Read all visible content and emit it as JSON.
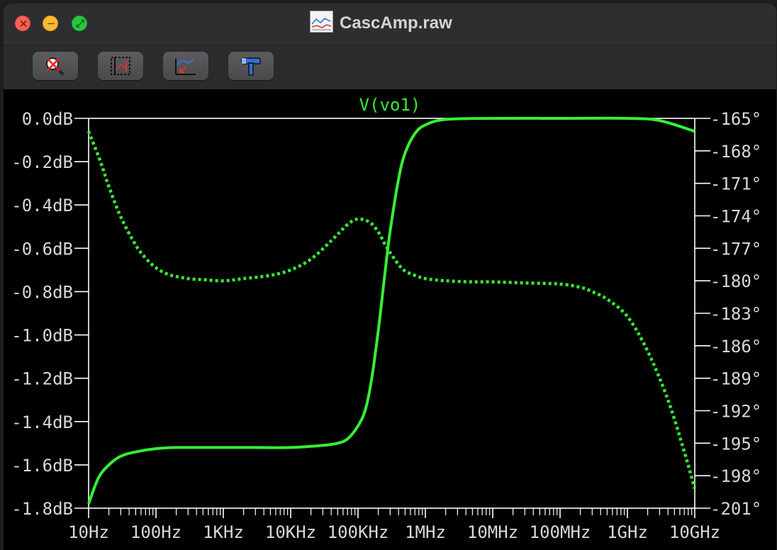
{
  "window": {
    "title": "CascAmp.raw"
  },
  "toolbar": {
    "buttons": [
      {
        "name": "zoom-cancel",
        "icon": "magnifier-cancel-icon"
      },
      {
        "name": "autorange",
        "icon": "autorange-icon"
      },
      {
        "name": "zoom-full",
        "icon": "zoom-full-icon"
      },
      {
        "name": "settings",
        "icon": "hammer-icon"
      }
    ]
  },
  "colors": {
    "trace": "#35ef35",
    "axis": "#ffffff",
    "text": "#d8d8d8",
    "background": "#000000"
  },
  "chart_data": {
    "type": "line",
    "title": "V(vo1)",
    "xlabel": "",
    "ylabel": "",
    "x_scale": "log",
    "xlim": [
      10,
      10000000000
    ],
    "ylim": [
      -1.8,
      0.0
    ],
    "y2lim": [
      -201,
      -165
    ],
    "x_ticks": [
      "10Hz",
      "100Hz",
      "1KHz",
      "10KHz",
      "100KHz",
      "1MHz",
      "10MHz",
      "100MHz",
      "1GHz",
      "10GHz"
    ],
    "y_ticks": [
      "0.0dB",
      "-0.2dB",
      "-0.4dB",
      "-0.6dB",
      "-0.8dB",
      "-1.0dB",
      "-1.2dB",
      "-1.4dB",
      "-1.6dB",
      "-1.8dB"
    ],
    "y2_ticks": [
      "-165°",
      "-168°",
      "-171°",
      "-174°",
      "-177°",
      "-180°",
      "-183°",
      "-186°",
      "-189°",
      "-192°",
      "-195°",
      "-198°",
      "-201°"
    ],
    "grid": false,
    "series": [
      {
        "name": "magnitude",
        "axis": "left",
        "unit": "dB",
        "style": "solid",
        "x": [
          10,
          14,
          20,
          30,
          50,
          100,
          200,
          500,
          1000,
          3000,
          10000,
          30000,
          50000,
          70000,
          100000,
          130000,
          160000,
          200000,
          250000,
          300000,
          400000,
          500000,
          700000,
          1000000,
          2000000,
          10000000,
          100000000,
          1000000000,
          3000000000,
          10000000000
        ],
        "values": [
          -1.78,
          -1.66,
          -1.6,
          -1.56,
          -1.54,
          -1.525,
          -1.52,
          -1.52,
          -1.52,
          -1.52,
          -1.52,
          -1.51,
          -1.5,
          -1.48,
          -1.42,
          -1.34,
          -1.2,
          -0.98,
          -0.72,
          -0.52,
          -0.28,
          -0.16,
          -0.07,
          -0.03,
          -0.005,
          0.0,
          0.0,
          0.0,
          -0.01,
          -0.06
        ]
      },
      {
        "name": "phase",
        "axis": "right",
        "unit": "°",
        "style": "dotted",
        "x": [
          10,
          15,
          20,
          30,
          50,
          70,
          100,
          150,
          200,
          300,
          500,
          1000,
          2000,
          5000,
          10000,
          20000,
          40000,
          70000,
          100000,
          150000,
          200000,
          250000,
          300000,
          400000,
          500000,
          700000,
          1000000,
          2000000,
          5000000,
          10000000,
          30000000,
          100000000,
          200000000,
          300000000,
          500000000,
          1000000000,
          2000000000,
          4000000000,
          7000000000,
          10000000000
        ],
        "values": [
          -166.2,
          -169,
          -171.3,
          -174.1,
          -176.7,
          -177.9,
          -178.8,
          -179.4,
          -179.6,
          -179.8,
          -179.9,
          -180,
          -179.8,
          -179.5,
          -179,
          -178,
          -176.3,
          -174.8,
          -174.3,
          -174.6,
          -175.5,
          -176.6,
          -177.4,
          -178.5,
          -179.1,
          -179.5,
          -179.8,
          -180,
          -180.1,
          -180.1,
          -180.2,
          -180.3,
          -180.6,
          -181,
          -181.7,
          -183.3,
          -186.5,
          -191,
          -195.8,
          -199.2
        ]
      }
    ]
  }
}
